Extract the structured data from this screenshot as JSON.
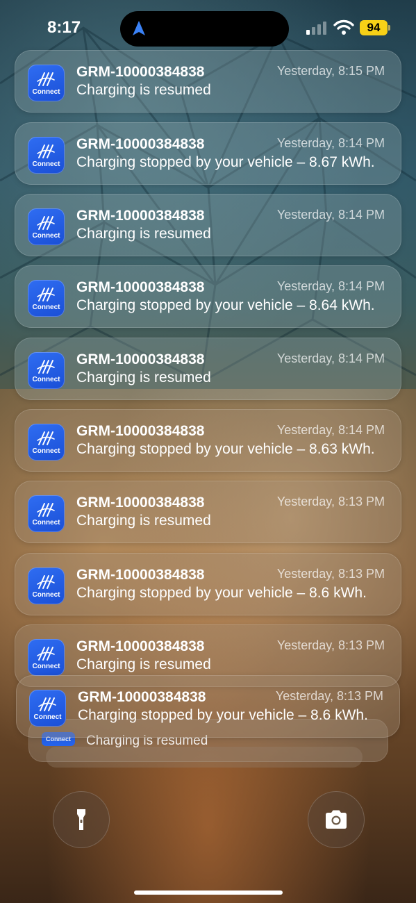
{
  "status_bar": {
    "time": "8:17",
    "battery": "94"
  },
  "app": {
    "icon_label": "Connect",
    "icon_color": "#2563eb"
  },
  "notifications": [
    {
      "title": "GRM-10000384838",
      "body": "Charging is resumed",
      "time": "Yesterday, 8:15 PM"
    },
    {
      "title": "GRM-10000384838",
      "body": "Charging stopped by your vehicle – 8.67 kWh.",
      "time": "Yesterday, 8:14 PM"
    },
    {
      "title": "GRM-10000384838",
      "body": "Charging is resumed",
      "time": "Yesterday, 8:14 PM"
    },
    {
      "title": "GRM-10000384838",
      "body": "Charging stopped by your vehicle – 8.64 kWh.",
      "time": "Yesterday, 8:14 PM"
    },
    {
      "title": "GRM-10000384838",
      "body": "Charging is resumed",
      "time": "Yesterday, 8:14 PM"
    },
    {
      "title": "GRM-10000384838",
      "body": "Charging stopped by your vehicle – 8.63 kWh.",
      "time": "Yesterday, 8:14 PM"
    },
    {
      "title": "GRM-10000384838",
      "body": "Charging is resumed",
      "time": "Yesterday, 8:13 PM"
    },
    {
      "title": "GRM-10000384838",
      "body": "Charging stopped by your vehicle – 8.6 kWh.",
      "time": "Yesterday, 8:13 PM"
    },
    {
      "title": "GRM-10000384838",
      "body": "Charging is resumed",
      "time": "Yesterday, 8:13 PM"
    },
    {
      "title": "GRM-10000384838",
      "body": "Charging stopped by your vehicle – 8.6 kWh.",
      "time": "Yesterday, 8:13 PM"
    }
  ],
  "stack_peek": {
    "body": "Charging is resumed"
  },
  "controls": {
    "flashlight_icon": "flashlight-icon",
    "camera_icon": "camera-icon"
  }
}
